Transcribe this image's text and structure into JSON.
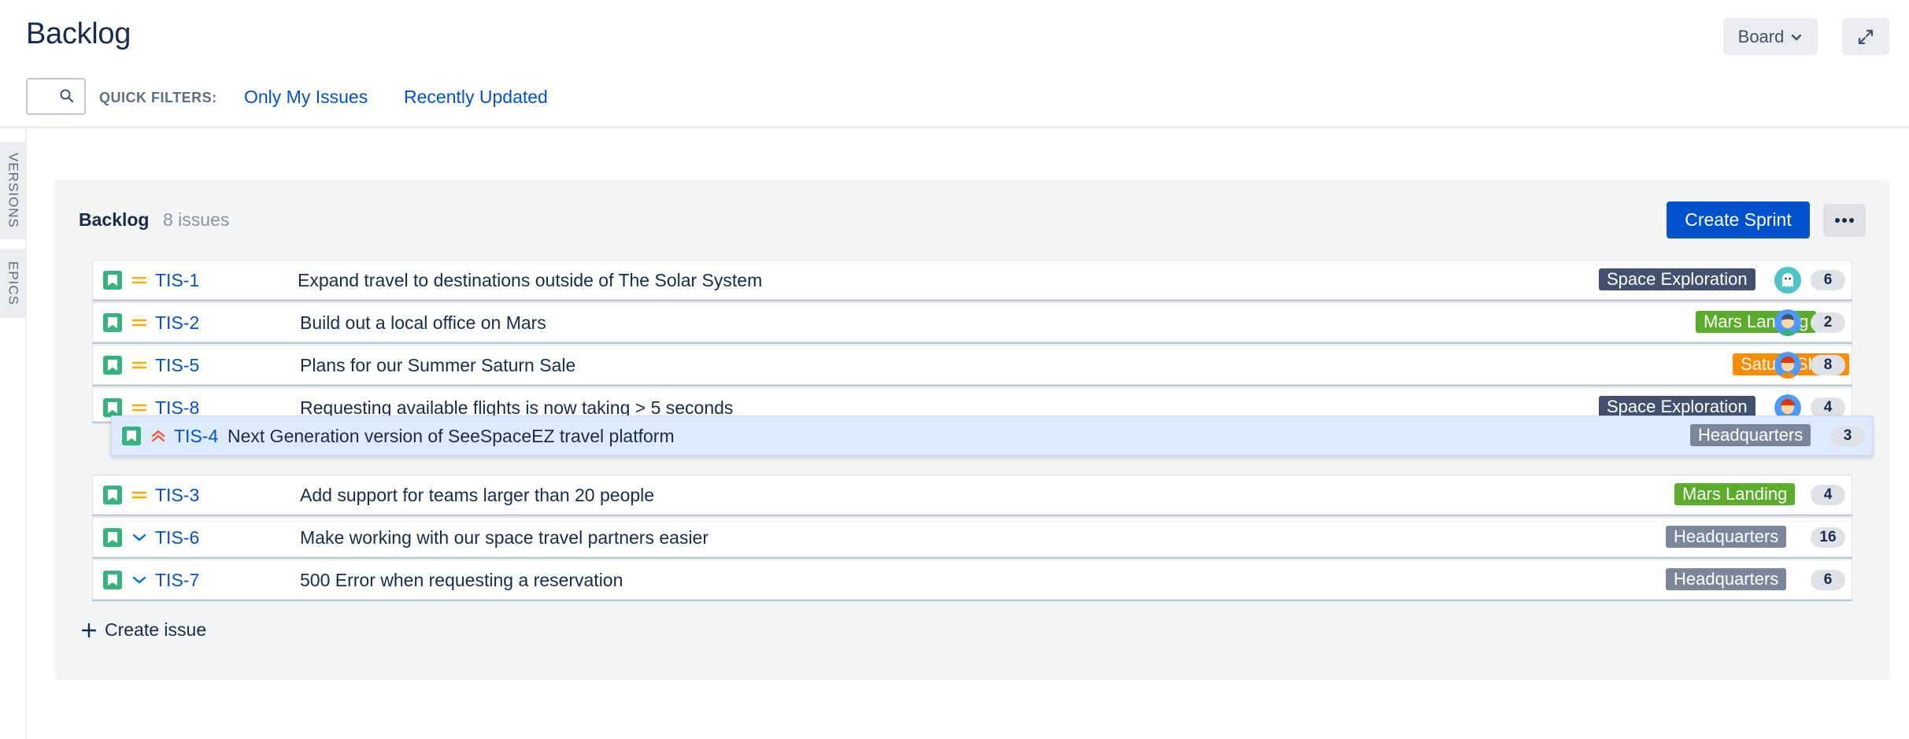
{
  "header": {
    "title": "Backlog",
    "board_label": "Board",
    "quick_filters_label": "QUICK FILTERS:",
    "quick_filters": [
      "Only My Issues",
      "Recently Updated"
    ]
  },
  "side_tabs": [
    "VERSIONS",
    "EPICS"
  ],
  "backlog": {
    "title": "Backlog",
    "count": "8 issues",
    "create_sprint_label": "Create Sprint",
    "create_issue_label": "Create issue",
    "issues": [
      {
        "key": "TIS-1",
        "summary": "Expand travel to destinations outside of The Solar System",
        "epic": "Space Exploration",
        "epic_color": "#42526e",
        "priority": "medium",
        "avatar": "ghost",
        "points": "6"
      },
      {
        "key": "TIS-2",
        "summary": "Build out a local office on Mars",
        "epic": "Mars Landing",
        "epic_color": "#5aac2a",
        "priority": "medium",
        "avatar": "person-blue",
        "points": "2"
      },
      {
        "key": "TIS-5",
        "summary": "Plans for our Summer Saturn Sale",
        "epic": "Saturn Shoot",
        "epic_color": "#ff8b00",
        "priority": "medium",
        "avatar": "person-red",
        "points": "8"
      },
      {
        "key": "TIS-8",
        "summary": "Requesting available flights is now taking > 5 seconds",
        "epic": "Space Exploration",
        "epic_color": "#42526e",
        "priority": "medium",
        "avatar": "person-red",
        "points": "4"
      },
      {
        "key": "TIS-4",
        "summary": "Next Generation version of SeeSpaceEZ travel platform",
        "epic": "Headquarters",
        "epic_color": "#7a869a",
        "priority": "highest",
        "avatar": "",
        "points": "3"
      },
      {
        "key": "TIS-3",
        "summary": "Add support for teams larger than 20 people",
        "epic": "Mars Landing",
        "epic_color": "#5aac2a",
        "priority": "medium",
        "avatar": "",
        "points": "4"
      },
      {
        "key": "TIS-6",
        "summary": "Make working with our space travel partners easier",
        "epic": "Headquarters",
        "epic_color": "#7a869a",
        "priority": "low",
        "avatar": "",
        "points": "16"
      },
      {
        "key": "TIS-7",
        "summary": "500 Error when requesting a reservation",
        "epic": "Headquarters",
        "epic_color": "#7a869a",
        "priority": "low",
        "avatar": "",
        "points": "6"
      }
    ]
  },
  "icons": {
    "story": "bookmark-icon",
    "priority_medium": "equals-icon",
    "priority_highest": "double-chevron-up-icon",
    "priority_low": "chevron-down-icon",
    "search": "search-icon",
    "expand": "expand-icon",
    "more": "more-icon",
    "add": "plus-icon"
  },
  "colors": {
    "primary": "#0052cc",
    "story": "#36b37e",
    "priority_medium": "#ffab00",
    "priority_highest": "#ff5630",
    "priority_low": "#0065ff",
    "drag_row": "#deebff"
  }
}
